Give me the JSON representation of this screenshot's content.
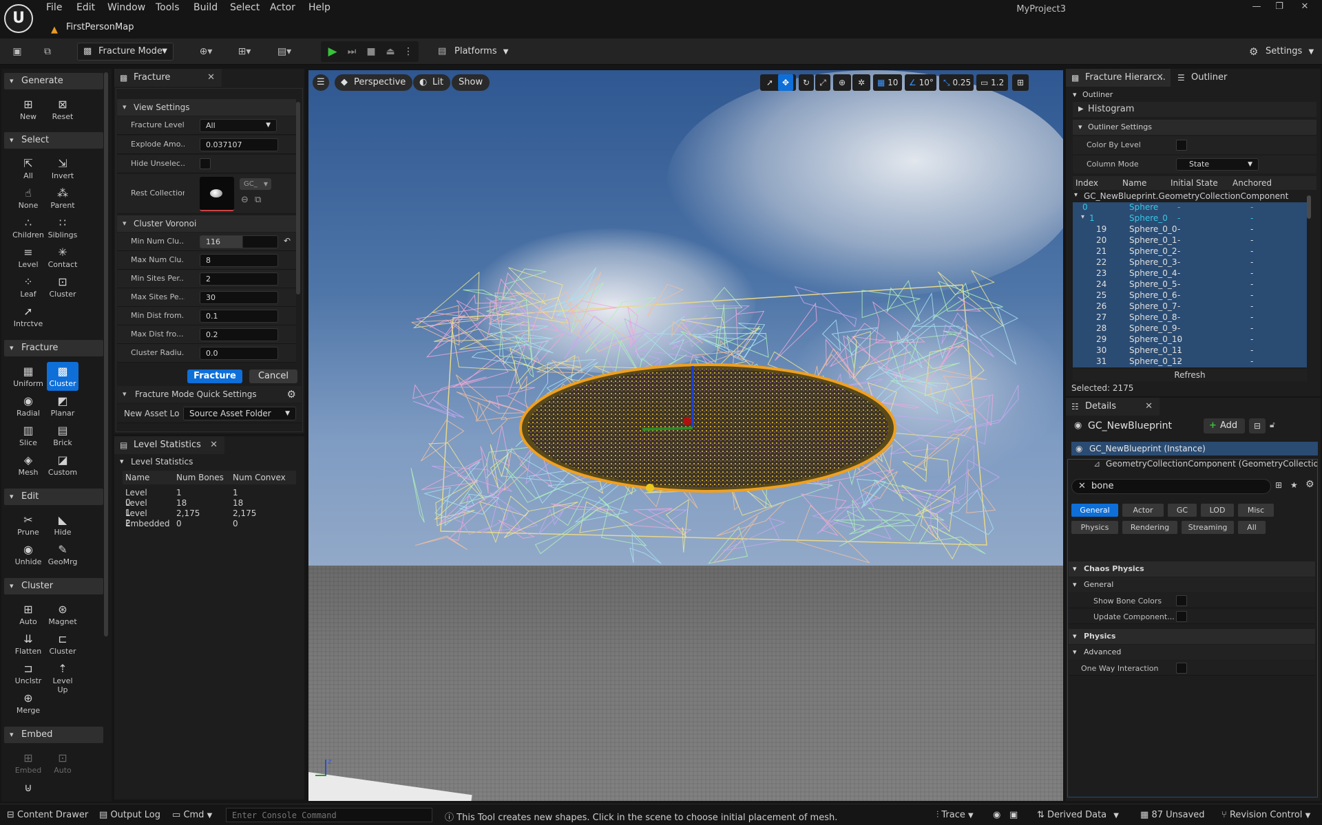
{
  "titlebar": {
    "logo": "U",
    "menus": [
      "File",
      "Edit",
      "Window",
      "Tools",
      "Build",
      "Select",
      "Actor",
      "Help"
    ],
    "project": "MyProject3",
    "map_tab": "FirstPersonMap"
  },
  "toolbar": {
    "mode_label": "Fracture Mode",
    "platforms_label": "Platforms",
    "settings_label": "Settings"
  },
  "left_tools": {
    "generate": {
      "title": "Generate",
      "items": [
        "New",
        "Reset"
      ]
    },
    "select": {
      "title": "Select",
      "items": [
        "All",
        "Invert",
        "None",
        "Parent",
        "Children",
        "Siblings",
        "Level",
        "Contact",
        "Leaf",
        "Cluster",
        "Intrctve"
      ]
    },
    "fracture": {
      "title": "Fracture",
      "items": [
        "Uniform",
        "Cluster",
        "Radial",
        "Planar",
        "Slice",
        "Brick",
        "Mesh",
        "Custom"
      ],
      "selected": "Cluster"
    },
    "edit": {
      "title": "Edit",
      "items": [
        "Prune",
        "Hide",
        "Unhide",
        "GeoMrg"
      ]
    },
    "cluster": {
      "title": "Cluster",
      "items": [
        "Auto",
        "Magnet",
        "Flatten",
        "Cluster",
        "Unclstr",
        "Level Up",
        "Merge"
      ]
    },
    "embed": {
      "title": "Embed",
      "items": [
        "Embed",
        "Auto"
      ]
    }
  },
  "fracture_panel": {
    "tab": "Fracture",
    "view_settings": "View Settings",
    "fracture_level_label": "Fracture Level",
    "fracture_level_value": "All",
    "explode_label": "Explode Amo...",
    "explode_value": "0.037107",
    "hide_unselected_label": "Hide Unselec...",
    "rest_collection_label": "Rest Collection",
    "rest_collection_value": "GC_",
    "cluster_voronoi": "Cluster Voronoi",
    "props": [
      {
        "label": "Min Num Clu...",
        "value": "116"
      },
      {
        "label": "Max Num Clu...",
        "value": "8"
      },
      {
        "label": "Min Sites Per...",
        "value": "2"
      },
      {
        "label": "Max Sites Pe...",
        "value": "30"
      },
      {
        "label": "Min Dist from...",
        "value": "0.1"
      },
      {
        "label": "Max Dist fro...",
        "value": "0.2"
      },
      {
        "label": "Cluster Radiu...",
        "value": "0.0"
      }
    ],
    "fracture_button": "Fracture",
    "cancel_button": "Cancel",
    "quick_settings": "Fracture Mode Quick Settings",
    "new_asset_label": "New Asset Loc",
    "new_asset_value": "Source Asset Folder"
  },
  "level_stats": {
    "tab": "Level Statistics",
    "section": "Level Statistics",
    "headers": [
      "Name",
      "Num Bones",
      "Num Convex"
    ],
    "rows": [
      [
        "Level 0",
        "1",
        "1"
      ],
      [
        "Level 1",
        "18",
        "18"
      ],
      [
        "Level 2",
        "2,175",
        "2,175"
      ],
      [
        "Embedded",
        "0",
        "0"
      ]
    ]
  },
  "viewport": {
    "perspective": "Perspective",
    "lit": "Lit",
    "show": "Show",
    "grid": "10",
    "angle": "10°",
    "scale": "0.25",
    "camera": "1.2",
    "axis_z": "z"
  },
  "fracture_hierarchy": {
    "tab1": "Fracture Hierarc...",
    "tab2": "Outliner",
    "outliner_section": "Outliner",
    "histogram": "Histogram",
    "settings_section": "Outliner Settings",
    "color_by_level": "Color By Level",
    "column_mode_label": "Column Mode",
    "column_mode_value": "State",
    "columns": [
      "Index",
      "Name",
      "Initial State",
      "Anchored"
    ],
    "root": "GC_NewBlueprint.GeometryCollectionComponent",
    "rows": [
      [
        "0",
        "Sphere",
        "-",
        "-"
      ],
      [
        "1",
        "Sphere_0",
        "-",
        "-"
      ],
      [
        "19",
        "Sphere_0_0",
        "-",
        "-"
      ],
      [
        "20",
        "Sphere_0_1",
        "-",
        "-"
      ],
      [
        "21",
        "Sphere_0_2",
        "-",
        "-"
      ],
      [
        "22",
        "Sphere_0_3",
        "-",
        "-"
      ],
      [
        "23",
        "Sphere_0_4",
        "-",
        "-"
      ],
      [
        "24",
        "Sphere_0_5",
        "-",
        "-"
      ],
      [
        "25",
        "Sphere_0_6",
        "-",
        "-"
      ],
      [
        "26",
        "Sphere_0_7",
        "-",
        "-"
      ],
      [
        "27",
        "Sphere_0_8",
        "-",
        "-"
      ],
      [
        "28",
        "Sphere_0_9",
        "-",
        "-"
      ],
      [
        "29",
        "Sphere_0_10",
        "-",
        "-"
      ],
      [
        "30",
        "Sphere_0_11",
        "-",
        "-"
      ],
      [
        "31",
        "Sphere_0_12",
        "-",
        "-"
      ]
    ],
    "refresh": "Refresh",
    "selected": "Selected: 2175"
  },
  "details": {
    "tab": "Details",
    "actor_name": "GC_NewBlueprint",
    "add_button": "Add",
    "instance": "GC_NewBlueprint (Instance)",
    "component": "GeometryCollectionComponent (GeometryCollection",
    "search_value": "bone",
    "filters_row1": [
      "General",
      "Actor",
      "GC",
      "LOD",
      "Misc"
    ],
    "filters_row2": [
      "Physics",
      "Rendering",
      "Streaming",
      "All"
    ],
    "chaos_physics": "Chaos Physics",
    "general": "General",
    "show_bone_colors": "Show Bone Colors",
    "update_component": "Update Component...",
    "physics": "Physics",
    "advanced": "Advanced",
    "one_way": "One Way Interaction"
  },
  "statusbar": {
    "content_drawer": "Content Drawer",
    "output_log": "Output Log",
    "cmd": "Cmd",
    "console_placeholder": "Enter Console Command",
    "hint": "This Tool creates new shapes. Click in the scene to choose initial placement of mesh.",
    "trace": "Trace",
    "derived_data": "Derived Data",
    "unsaved": "87 Unsaved",
    "revision_control": "Revision Control"
  },
  "colors": {
    "accent": "#0e6fd8",
    "selection_row": "#2a4b72",
    "hierarchy_cyan": "#35c8e8",
    "ellipse_outline": "#f0a020"
  }
}
